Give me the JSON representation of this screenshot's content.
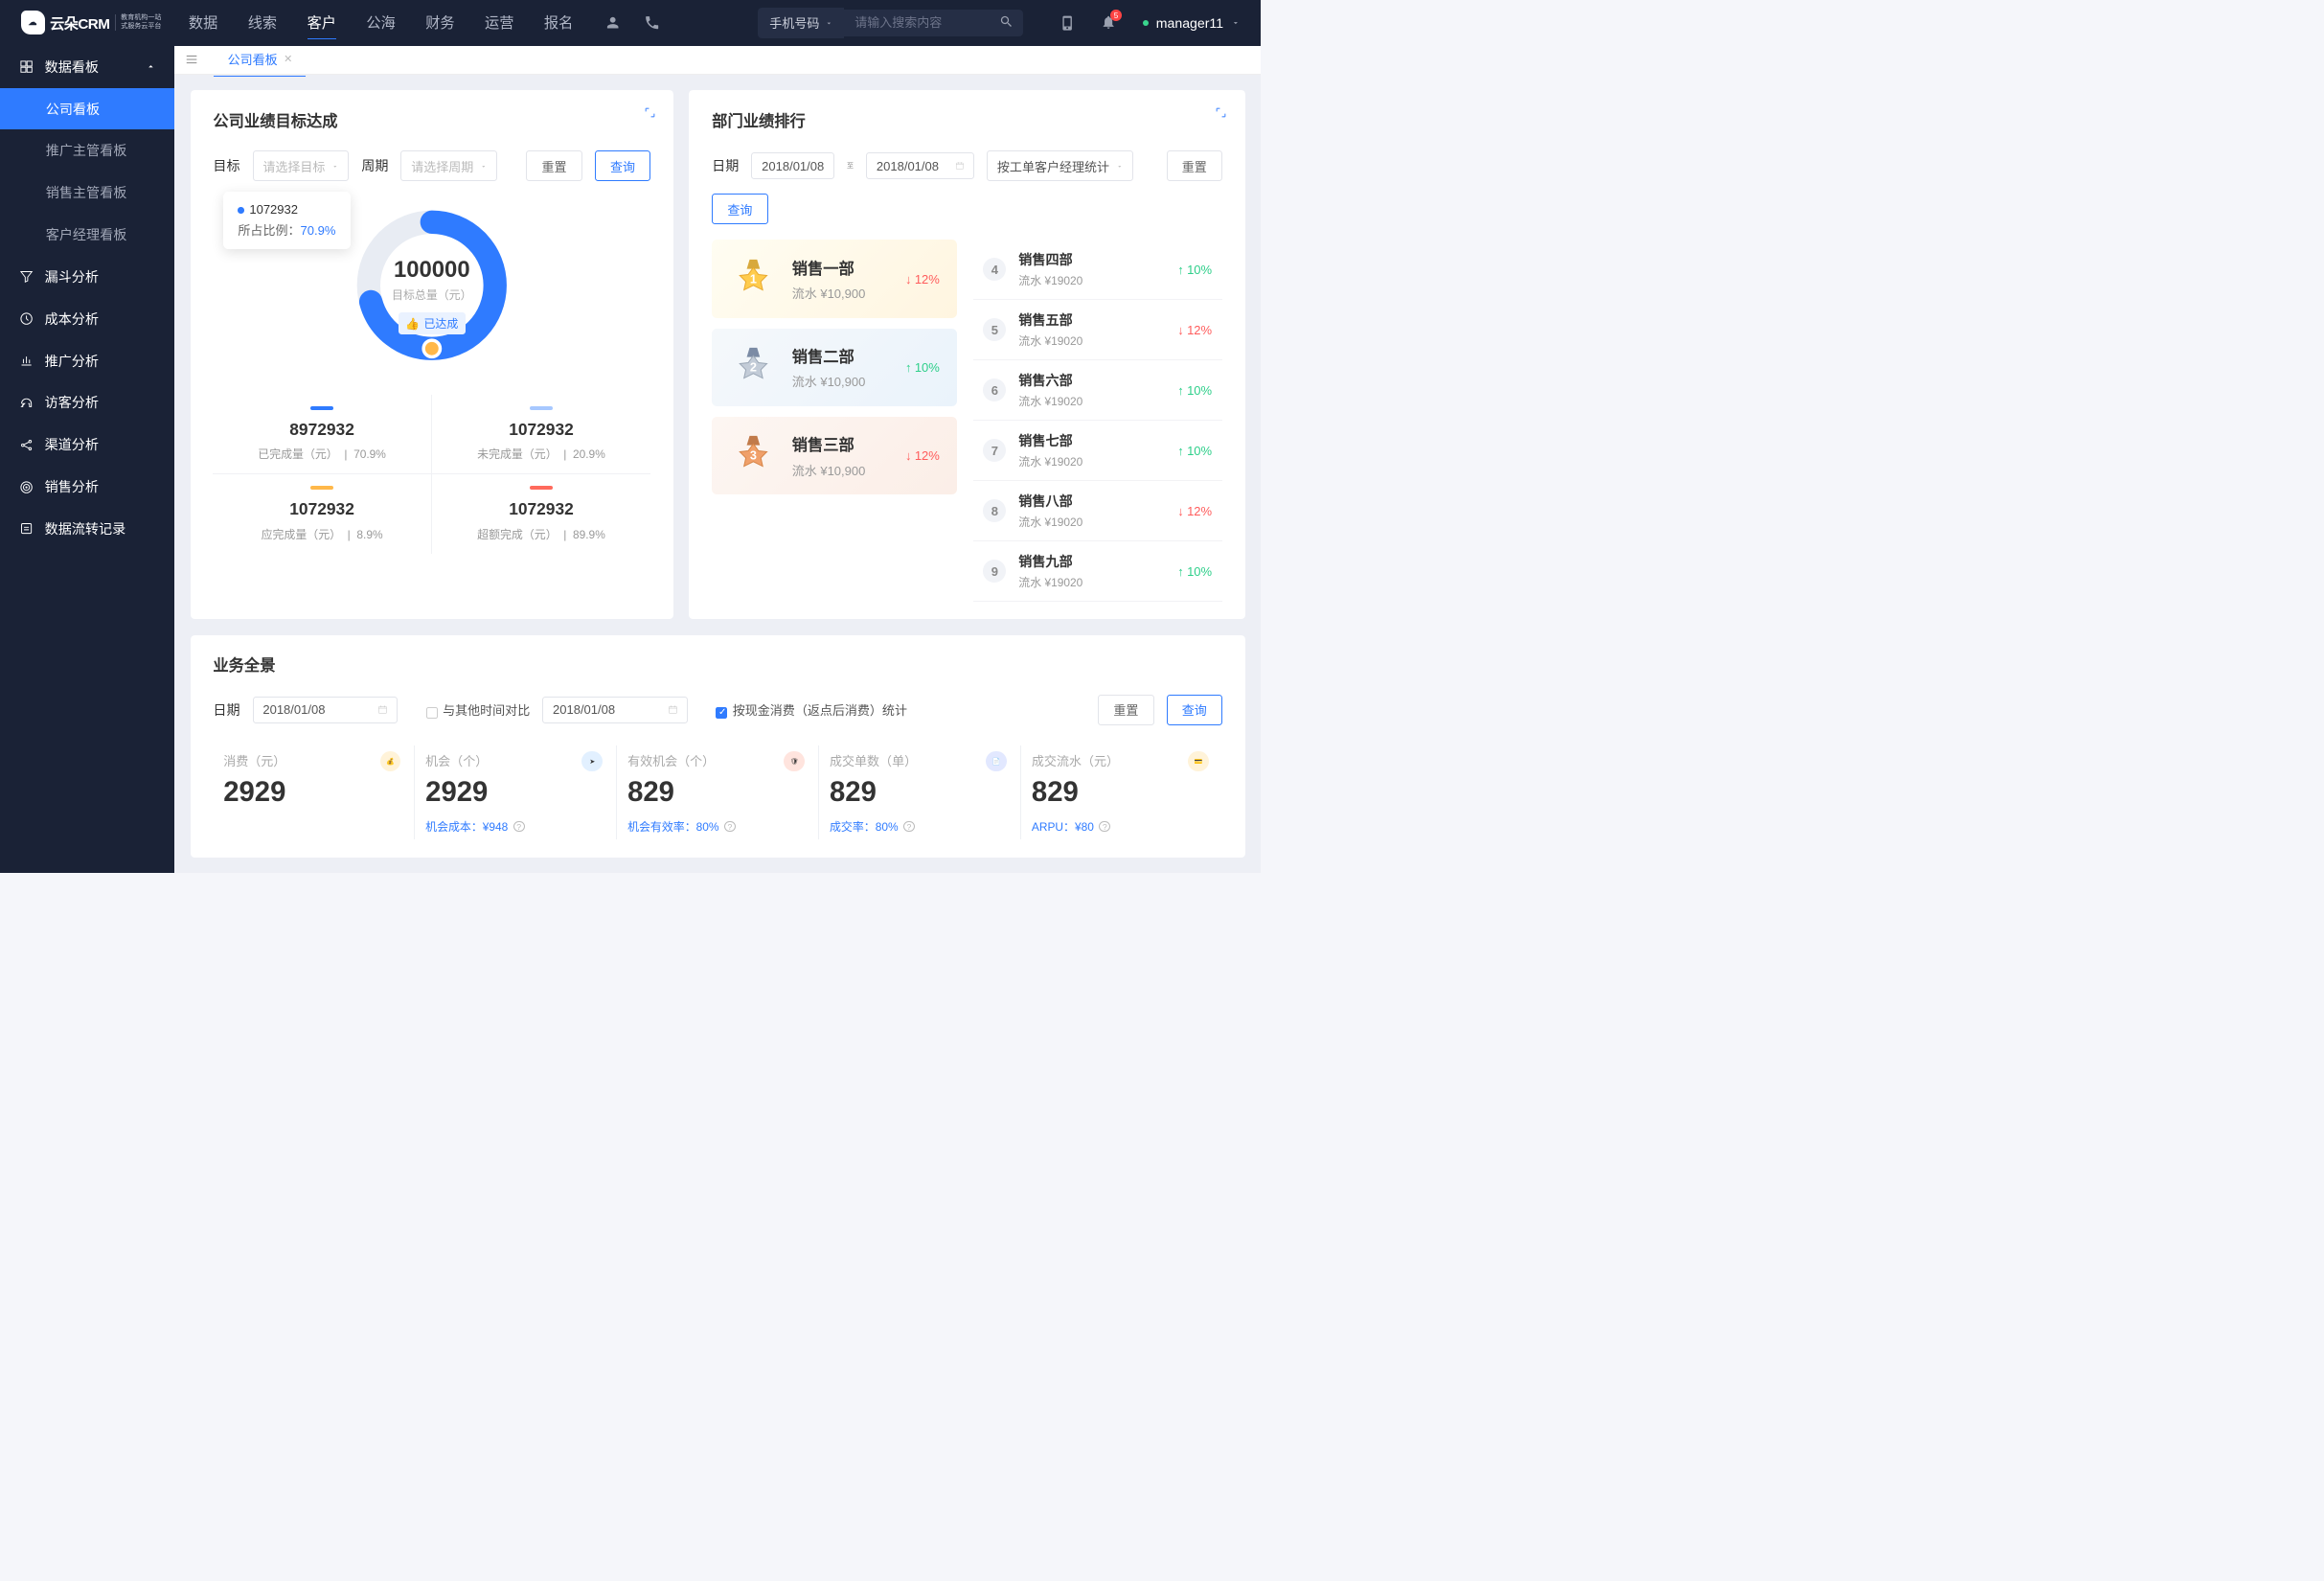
{
  "logo": {
    "main": "云朵CRM",
    "sub1": "教育机构一站",
    "sub2": "式服务云平台"
  },
  "topnav": {
    "items": [
      "数据",
      "线索",
      "客户",
      "公海",
      "财务",
      "运营",
      "报名"
    ],
    "active_idx": 2,
    "search_type": "手机号码",
    "search_placeholder": "请输入搜索内容",
    "badge": "5",
    "user": "manager11"
  },
  "sidebar": {
    "group": "数据看板",
    "items": [
      "公司看板",
      "推广主管看板",
      "销售主管看板",
      "客户经理看板"
    ],
    "active_idx": 0,
    "menu": [
      "漏斗分析",
      "成本分析",
      "推广分析",
      "访客分析",
      "渠道分析",
      "销售分析",
      "数据流转记录"
    ]
  },
  "tab": {
    "label": "公司看板"
  },
  "card1": {
    "title": "公司业绩目标达成",
    "target_label": "目标",
    "target_placeholder": "请选择目标",
    "period_label": "周期",
    "period_placeholder": "请选择周期",
    "reset": "重置",
    "query": "查询",
    "tooltip_val": "1072932",
    "tooltip_pct_label": "所占比例：",
    "tooltip_pct": "70.9%",
    "center_val": "100000",
    "center_sub": "目标总量（元）",
    "center_badge": "已达成",
    "stats": [
      {
        "color": "#2f7bff",
        "val": "8972932",
        "lab": "已完成量（元）",
        "pct": "70.9%"
      },
      {
        "color": "#a7c8ff",
        "val": "1072932",
        "lab": "未完成量（元）",
        "pct": "20.9%"
      },
      {
        "color": "#ffb84a",
        "val": "1072932",
        "lab": "应完成量（元）",
        "pct": "8.9%"
      },
      {
        "color": "#ff6a5c",
        "val": "1072932",
        "lab": "超额完成（元）",
        "pct": "89.9%"
      }
    ]
  },
  "card2": {
    "title": "部门业绩排行",
    "date_label": "日期",
    "date_from": "2018/01/08",
    "date_to_label": "至",
    "date_to": "2018/01/08",
    "stat_mode": "按工单客户经理统计",
    "reset": "重置",
    "query": "查询",
    "top3": [
      {
        "rank": "1",
        "name": "销售一部",
        "amt": "流水 ¥10,900",
        "pct": "12%",
        "dir": "down"
      },
      {
        "rank": "2",
        "name": "销售二部",
        "amt": "流水 ¥10,900",
        "pct": "10%",
        "dir": "up"
      },
      {
        "rank": "3",
        "name": "销售三部",
        "amt": "流水 ¥10,900",
        "pct": "12%",
        "dir": "down"
      }
    ],
    "rest": [
      {
        "rank": "4",
        "name": "销售四部",
        "amt": "流水 ¥19020",
        "pct": "10%",
        "dir": "up"
      },
      {
        "rank": "5",
        "name": "销售五部",
        "amt": "流水 ¥19020",
        "pct": "12%",
        "dir": "down"
      },
      {
        "rank": "6",
        "name": "销售六部",
        "amt": "流水 ¥19020",
        "pct": "10%",
        "dir": "up"
      },
      {
        "rank": "7",
        "name": "销售七部",
        "amt": "流水 ¥19020",
        "pct": "10%",
        "dir": "up"
      },
      {
        "rank": "8",
        "name": "销售八部",
        "amt": "流水 ¥19020",
        "pct": "12%",
        "dir": "down"
      },
      {
        "rank": "9",
        "name": "销售九部",
        "amt": "流水 ¥19020",
        "pct": "10%",
        "dir": "up"
      }
    ]
  },
  "card3": {
    "title": "业务全景",
    "date_label": "日期",
    "date1": "2018/01/08",
    "compare_label": "与其他时间对比",
    "date2": "2018/01/08",
    "cash_label": "按现金消费（返点后消费）统计",
    "reset": "重置",
    "query": "查询",
    "cards": [
      {
        "lbl": "消费（元）",
        "num": "2929",
        "sub": "",
        "ic": "#ffb84a"
      },
      {
        "lbl": "机会（个）",
        "num": "2929",
        "sub": "机会成本：¥948",
        "ic": "#3a9bff"
      },
      {
        "lbl": "有效机会（个）",
        "num": "829",
        "sub": "机会有效率：80%",
        "ic": "#ff6a5c"
      },
      {
        "lbl": "成交单数（单）",
        "num": "829",
        "sub": "成交率：80%",
        "ic": "#3a6eff"
      },
      {
        "lbl": "成交流水（元）",
        "num": "829",
        "sub": "ARPU：¥80",
        "ic": "#ffb84a"
      }
    ]
  },
  "chart_data": {
    "type": "pie",
    "title": "公司业绩目标达成",
    "center_total": 100000,
    "series": [
      {
        "name": "已完成量（元）",
        "value": 8972932,
        "pct": 70.9,
        "color": "#2f7bff"
      },
      {
        "name": "未完成量（元）",
        "value": 1072932,
        "pct": 20.9,
        "color": "#a7c8ff"
      },
      {
        "name": "应完成量（元）",
        "value": 1072932,
        "pct": 8.9,
        "color": "#ffb84a"
      },
      {
        "name": "超额完成（元）",
        "value": 1072932,
        "pct": 89.9,
        "color": "#ff6a5c"
      }
    ]
  }
}
